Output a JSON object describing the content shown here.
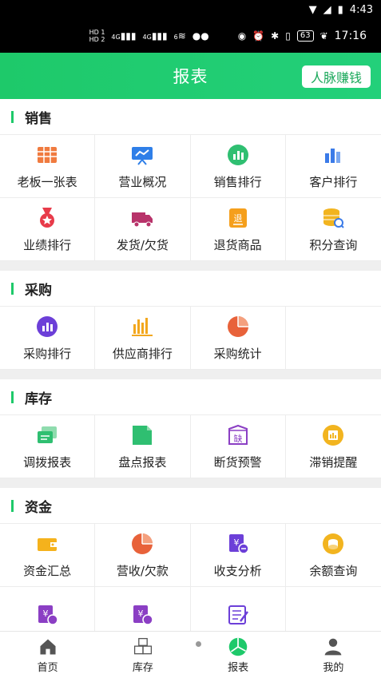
{
  "system_bar": {
    "time": "4:43"
  },
  "status_bar": {
    "hd1": "HD 1",
    "hd2": "HD 2",
    "sig1": "4G",
    "sig2": "4G",
    "wifi_gen": "6",
    "battery": "63",
    "time": "17:16"
  },
  "header": {
    "title": "报表",
    "action_label": "人脉赚钱"
  },
  "sections": [
    {
      "title": "销售",
      "items": [
        {
          "label": "老板一张表",
          "icon": "table-icon",
          "color": "#f07b3f"
        },
        {
          "label": "营业概况",
          "icon": "presentation-icon",
          "color": "#2f7fe8"
        },
        {
          "label": "销售排行",
          "icon": "bar-chart-circle-icon",
          "color": "#2fbf71"
        },
        {
          "label": "客户排行",
          "icon": "column-chart-icon",
          "color": "#3b7be8"
        },
        {
          "label": "业绩排行",
          "icon": "medal-icon",
          "color": "#e83b4a"
        },
        {
          "label": "发货/欠货",
          "icon": "truck-icon",
          "color": "#b8336a"
        },
        {
          "label": "退货商品",
          "icon": "return-box-icon",
          "color": "#f59f1c"
        },
        {
          "label": "积分查询",
          "icon": "coins-search-icon",
          "color": "#f2b41f"
        }
      ]
    },
    {
      "title": "采购",
      "items": [
        {
          "label": "采购排行",
          "icon": "purchase-rank-icon",
          "color": "#6c3fd8"
        },
        {
          "label": "供应商排行",
          "icon": "supplier-chart-icon",
          "color": "#f2a71d"
        },
        {
          "label": "采购统计",
          "icon": "pie-chart-icon",
          "color": "#e8623a"
        }
      ]
    },
    {
      "title": "库存",
      "items": [
        {
          "label": "调拨报表",
          "icon": "transfer-icon",
          "color": "#2fbf71"
        },
        {
          "label": "盘点报表",
          "icon": "folder-report-icon",
          "color": "#2fbf71"
        },
        {
          "label": "断货预警",
          "icon": "shortage-box-icon",
          "color": "#8b3fc4",
          "glyph": "缺"
        },
        {
          "label": "滞销提醒",
          "icon": "slow-sales-icon",
          "color": "#f2b41f"
        }
      ]
    },
    {
      "title": "资金",
      "items": [
        {
          "label": "资金汇总",
          "icon": "wallet-icon",
          "color": "#f5b21c"
        },
        {
          "label": "营收/欠款",
          "icon": "revenue-pie-icon",
          "color": "#e8623a"
        },
        {
          "label": "收支分析",
          "icon": "income-expense-icon",
          "color": "#6c3fd8",
          "glyph": "¥"
        },
        {
          "label": "余额查询",
          "icon": "balance-icon",
          "color": "#f2b41f"
        },
        {
          "label": "",
          "icon": "customer-money-icon",
          "color": "#8b3fc4",
          "glyph": "¥"
        },
        {
          "label": "",
          "icon": "supplier-money-icon",
          "color": "#8b3fc4",
          "glyph": "¥"
        },
        {
          "label": "",
          "icon": "notepad-icon",
          "color": "#6c3fd8"
        }
      ]
    }
  ],
  "bottom_nav": [
    {
      "label": "首页",
      "icon": "home-icon",
      "color": "#555555"
    },
    {
      "label": "库存",
      "icon": "boxes-icon",
      "color": "#555555"
    },
    {
      "label": "报表",
      "icon": "report-pie-icon",
      "color": "#1ec96a"
    },
    {
      "label": "我的",
      "icon": "person-icon",
      "color": "#555555"
    }
  ]
}
